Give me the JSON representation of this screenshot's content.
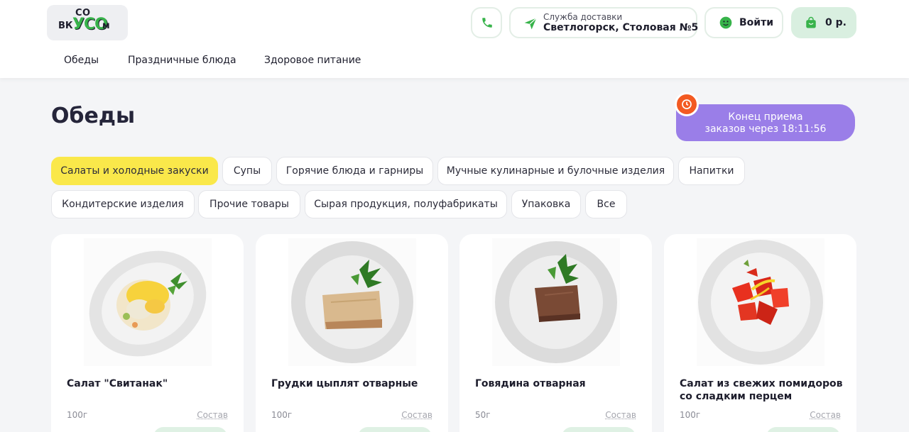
{
  "logo": {
    "line1": "СО",
    "line2": "ВК",
    "line3": "УСО",
    "line4": "м"
  },
  "header": {
    "delivery_label": "Служба доставки",
    "delivery_address": "Светлогорск, Столовая №5",
    "login_label": "Войти",
    "cart_total": "0 р.",
    "accent_color": "#37b34a",
    "icons": [
      "phone-icon",
      "send-icon",
      "user-icon",
      "bag-icon"
    ]
  },
  "nav": {
    "items": [
      "Обеды",
      "Праздничные блюда",
      "Здоровое питание"
    ]
  },
  "page": {
    "title": "Обеды"
  },
  "timer": {
    "line1": "Конец приема",
    "line2": "заказов через 18:11:56"
  },
  "categories": [
    "Салаты и холодные закуски",
    "Супы",
    "Горячие блюда и гарниры",
    "Мучные кулинарные и булочные изделия",
    "Напитки",
    "Кондитерские изделия",
    "Прочие товары",
    "Сырая продукция, полуфабрикаты",
    "Упаковка",
    "Все"
  ],
  "active_category": "Салаты и холодные закуски",
  "products": [
    {
      "name": "Салат \"Свитанак\"",
      "weight": "100г",
      "composition": "Состав"
    },
    {
      "name": "Грудки цыплят отварные",
      "weight": "100г",
      "composition": "Состав"
    },
    {
      "name": "Говядина отварная",
      "weight": "50г",
      "composition": "Состав"
    },
    {
      "name": "Салат из свежих помидоров со сладким перцем",
      "weight": "100г",
      "composition": "Состав"
    }
  ]
}
